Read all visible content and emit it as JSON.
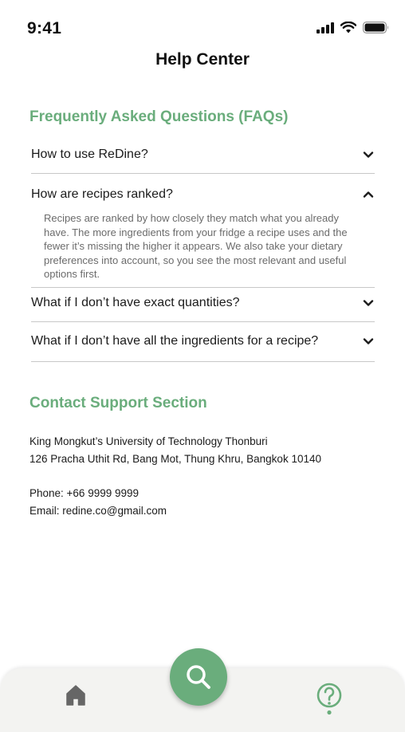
{
  "status_bar": {
    "time": "9:41"
  },
  "header": {
    "title": "Help Center"
  },
  "faq": {
    "title": "Frequently Asked Questions (FAQs)",
    "items": [
      {
        "question": "How to use ReDine?",
        "expanded": false
      },
      {
        "question": "How are recipes ranked?",
        "expanded": true,
        "answer": "Recipes are ranked by how closely they match what you already have. The more ingredients from your fridge a recipe uses and the fewer it’s missing the higher it appears. We also take your dietary preferences into account, so you see the most relevant and useful options first."
      },
      {
        "question": "What if I don’t have exact quantities?",
        "expanded": false
      },
      {
        "question": "What if I don’t have all the ingredients for a recipe?",
        "expanded": false
      }
    ]
  },
  "contact": {
    "title": "Contact Support Section",
    "institution": "King Mongkut’s University of Technology Thonburi",
    "address": "126 Pracha Uthit Rd, Bang Mot, Thung Khru, Bangkok 10140",
    "phone": "Phone: +66 9999 9999",
    "email": "Email: redine.co@gmail.com"
  },
  "nav": {
    "items": [
      "home-icon",
      "search-icon",
      "help-icon"
    ],
    "active": "help",
    "accent_color": "#6aad7c",
    "inactive_color": "#666666"
  }
}
